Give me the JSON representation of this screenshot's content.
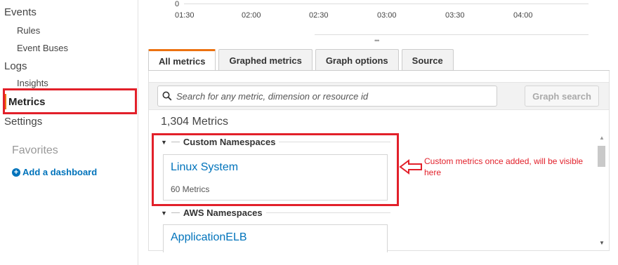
{
  "sidebar": {
    "items": [
      {
        "label": "Events"
      },
      {
        "label": "Rules"
      },
      {
        "label": "Event Buses"
      },
      {
        "label": "Logs"
      },
      {
        "label": "Insights"
      },
      {
        "label": "Metrics"
      },
      {
        "label": "Settings"
      }
    ],
    "favorites_label": "Favorites",
    "add_dashboard_label": "Add a dashboard"
  },
  "graph": {
    "y_zero": "0",
    "x_ticks": [
      "01:30",
      "02:00",
      "02:30",
      "03:00",
      "03:30",
      "04:00"
    ]
  },
  "tabs": [
    {
      "label": "All metrics",
      "active": true
    },
    {
      "label": "Graphed metrics"
    },
    {
      "label": "Graph options"
    },
    {
      "label": "Source"
    }
  ],
  "search": {
    "placeholder": "Search for any metric, dimension or resource id",
    "button_label": "Graph search"
  },
  "metric_count": "1,304 Metrics",
  "namespaces": [
    {
      "header": "Custom Namespaces",
      "cards": [
        {
          "title": "Linux System",
          "subtitle": "60 Metrics"
        }
      ]
    },
    {
      "header": "AWS Namespaces",
      "cards": [
        {
          "title": "ApplicationELB"
        }
      ]
    }
  ],
  "annotation": {
    "text": "Custom metrics once added, will be visible here",
    "color": "#e2202a"
  },
  "colors": {
    "accent": "#ec7211",
    "link": "#0073bb"
  }
}
